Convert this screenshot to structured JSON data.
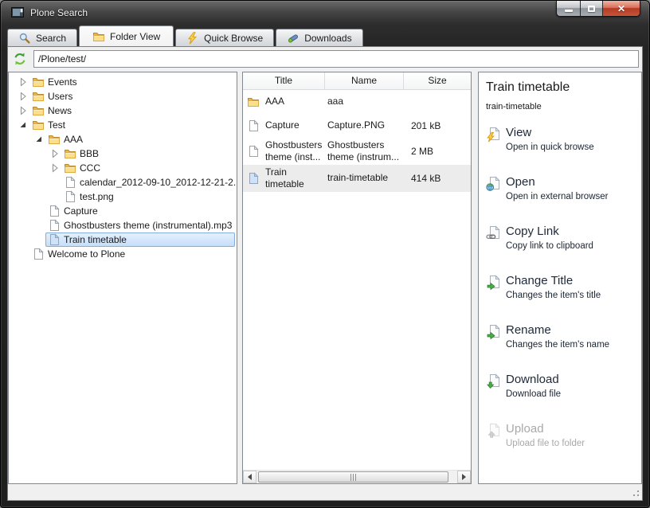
{
  "window": {
    "title": "Plone Search",
    "controls": [
      "minimize-icon",
      "maximize-icon",
      "close-icon"
    ]
  },
  "tabs": [
    {
      "label": "Search",
      "icon": "search-icon",
      "active": false
    },
    {
      "label": "Folder View",
      "icon": "folder-icon",
      "active": true
    },
    {
      "label": "Quick Browse",
      "icon": "quick-browse-icon",
      "active": false
    },
    {
      "label": "Downloads",
      "icon": "downloads-icon",
      "active": false
    }
  ],
  "toolbar": {
    "refresh_icon": "refresh-icon",
    "address_value": "/Plone/test/"
  },
  "tree": {
    "items": [
      {
        "label": "Events",
        "level": 0,
        "icon": "folder-icon",
        "expander": "collapsed"
      },
      {
        "label": "Users",
        "level": 0,
        "icon": "folder-icon",
        "expander": "collapsed"
      },
      {
        "label": "News",
        "level": 0,
        "icon": "folder-icon",
        "expander": "collapsed"
      },
      {
        "label": "Test",
        "level": 0,
        "icon": "folder-icon",
        "expander": "expanded"
      },
      {
        "label": "AAA",
        "level": 1,
        "icon": "folder-icon",
        "expander": "expanded"
      },
      {
        "label": "BBB",
        "level": 2,
        "icon": "folder-icon",
        "expander": "collapsed"
      },
      {
        "label": "CCC",
        "level": 2,
        "icon": "folder-icon",
        "expander": "collapsed"
      },
      {
        "label": "calendar_2012-09-10_2012-12-21-2....",
        "level": 2,
        "icon": "file-icon",
        "expander": "none"
      },
      {
        "label": "test.png",
        "level": 2,
        "icon": "file-icon",
        "expander": "none"
      },
      {
        "label": "Capture",
        "level": 1,
        "icon": "file-icon",
        "expander": "none"
      },
      {
        "label": "Ghostbusters theme (instrumental).mp3",
        "level": 1,
        "icon": "file-icon",
        "expander": "none"
      },
      {
        "label": "Train timetable",
        "level": 1,
        "icon": "file-blue-icon",
        "expander": "none",
        "selected": true
      },
      {
        "label": "Welcome to Plone",
        "level": 0,
        "icon": "file-icon",
        "expander": "none"
      }
    ]
  },
  "table": {
    "columns": [
      "Title",
      "Name",
      "Size"
    ],
    "rows": [
      {
        "title": "AAA",
        "name": "aaa",
        "size": "",
        "icon": "folder-icon"
      },
      {
        "title": "Capture",
        "name": "Capture.PNG",
        "size": "201 kB",
        "icon": "file-icon"
      },
      {
        "title": "Ghostbusters theme (inst...",
        "name": "Ghostbusters theme (instrum...",
        "size": "2 MB",
        "icon": "file-icon"
      },
      {
        "title": "Train timetable",
        "name": "train-timetable",
        "size": "414 kB",
        "icon": "file-blue-icon",
        "selected": true
      }
    ]
  },
  "details": {
    "title": "Train timetable",
    "name": "train-timetable",
    "actions": [
      {
        "label": "View",
        "desc": "Open in quick browse",
        "icon": "view-icon",
        "disabled": false
      },
      {
        "label": "Open",
        "desc": "Open in external browser",
        "icon": "open-icon",
        "disabled": false
      },
      {
        "label": "Copy Link",
        "desc": "Copy link to clipboard",
        "icon": "copy-link-icon",
        "disabled": false
      },
      {
        "label": "Change Title",
        "desc": "Changes the item's title",
        "icon": "change-title-icon",
        "disabled": false
      },
      {
        "label": "Rename",
        "desc": "Changes the item's name",
        "icon": "rename-icon",
        "disabled": false
      },
      {
        "label": "Download",
        "desc": "Download file",
        "icon": "download-icon",
        "disabled": false
      },
      {
        "label": "Upload",
        "desc": "Upload file to folder",
        "icon": "upload-icon",
        "disabled": true
      }
    ]
  },
  "colors": {
    "close_button_red": "#c0392b",
    "selection_blue_border": "#84acdd",
    "selection_blue_fill": "#cde3f9",
    "folder_yellow": "#f3c64f",
    "action_green": "#4caf46"
  }
}
